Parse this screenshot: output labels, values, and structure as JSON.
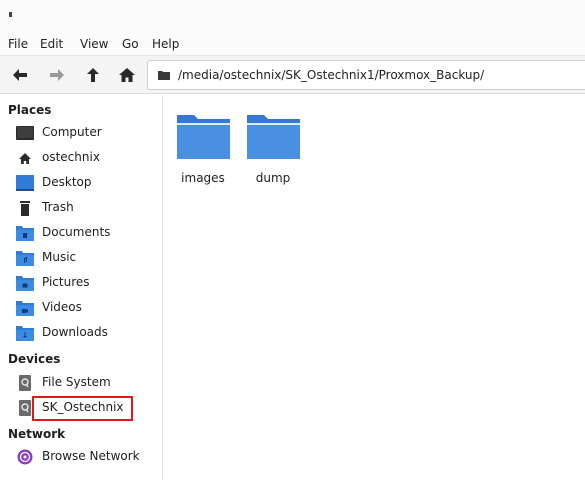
{
  "menubar": {
    "items": [
      {
        "label": "File"
      },
      {
        "label": "Edit"
      },
      {
        "label": "View"
      },
      {
        "label": "Go"
      },
      {
        "label": "Help"
      }
    ]
  },
  "toolbar": {
    "back_icon": "arrow-left-icon",
    "forward_icon": "arrow-right-icon",
    "up_icon": "arrow-up-icon",
    "home_icon": "home-icon",
    "path": "/media/ostechnix/SK_Ostechnix1/Proxmox_Backup/"
  },
  "sidebar": {
    "places_title": "Places",
    "places": [
      {
        "label": "Computer",
        "icon": "monitor-icon"
      },
      {
        "label": "ostechnix",
        "icon": "home-icon"
      },
      {
        "label": "Desktop",
        "icon": "desktop-icon"
      },
      {
        "label": "Trash",
        "icon": "trash-icon"
      },
      {
        "label": "Documents",
        "icon": "folder-documents-icon"
      },
      {
        "label": "Music",
        "icon": "folder-music-icon"
      },
      {
        "label": "Pictures",
        "icon": "folder-pictures-icon"
      },
      {
        "label": "Videos",
        "icon": "folder-videos-icon"
      },
      {
        "label": "Downloads",
        "icon": "folder-downloads-icon"
      }
    ],
    "devices_title": "Devices",
    "devices": [
      {
        "label": "File System",
        "icon": "drive-icon"
      },
      {
        "label": "SK_Ostechnix",
        "icon": "drive-icon"
      }
    ],
    "network_title": "Network",
    "network": [
      {
        "label": "Browse Network",
        "icon": "network-icon"
      }
    ]
  },
  "content": {
    "files": [
      {
        "label": "images",
        "icon": "folder-icon"
      },
      {
        "label": "dump",
        "icon": "folder-icon"
      }
    ]
  },
  "colors": {
    "folder": "#4a90e2",
    "highlight": "#e3171b"
  }
}
